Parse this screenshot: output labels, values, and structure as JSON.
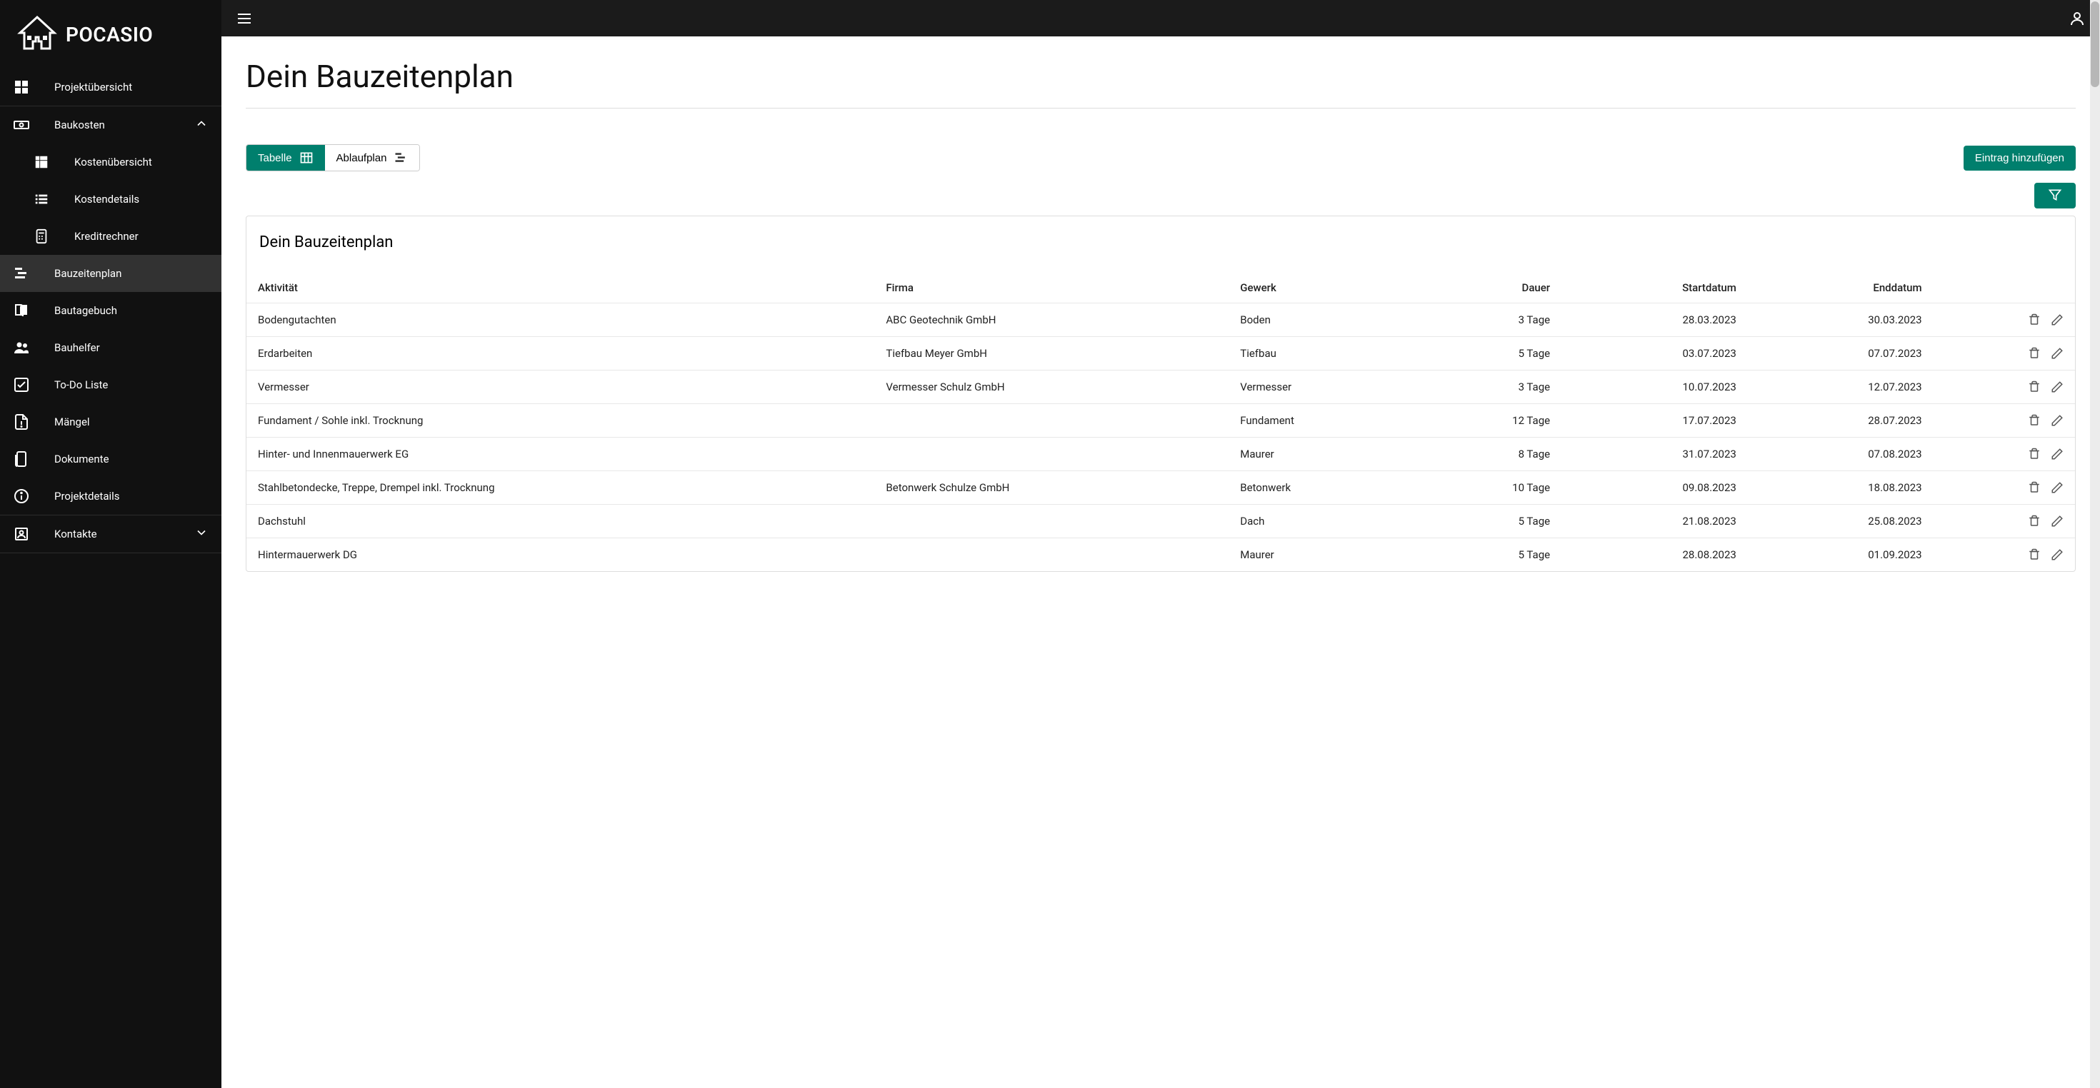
{
  "brand": {
    "name": "POCASIO"
  },
  "sidebar": {
    "items": [
      {
        "label": "Projektübersicht",
        "icon": "dashboard"
      },
      {
        "label": "Baukosten",
        "icon": "money",
        "expandable": true,
        "expanded": true,
        "children": [
          {
            "label": "Kostenübersicht",
            "icon": "grid"
          },
          {
            "label": "Kostendetails",
            "icon": "list"
          },
          {
            "label": "Kreditrechner",
            "icon": "calc"
          }
        ]
      },
      {
        "label": "Bauzeitenplan",
        "icon": "gantt",
        "active": true
      },
      {
        "label": "Bautagebuch",
        "icon": "book"
      },
      {
        "label": "Bauhelfer",
        "icon": "people"
      },
      {
        "label": "To-Do Liste",
        "icon": "check"
      },
      {
        "label": "Mängel",
        "icon": "note"
      },
      {
        "label": "Dokumente",
        "icon": "doc"
      },
      {
        "label": "Projektdetails",
        "icon": "info"
      },
      {
        "label": "Kontakte",
        "icon": "contacts",
        "expandable": true,
        "expanded": false
      }
    ]
  },
  "page": {
    "title": "Dein Bauzeitenplan",
    "tabs": {
      "table": "Tabelle",
      "gantt": "Ablaufplan"
    },
    "add_button": "Eintrag hinzufügen",
    "card_title": "Dein Bauzeitenplan"
  },
  "table": {
    "columns": [
      "Aktivität",
      "Firma",
      "Gewerk",
      "Dauer",
      "Startdatum",
      "Enddatum"
    ],
    "rows": [
      {
        "aktivitaet": "Bodengutachten",
        "firma": "ABC Geotechnik GmbH",
        "gewerk": "Boden",
        "dauer": "3 Tage",
        "start": "28.03.2023",
        "end": "30.03.2023"
      },
      {
        "aktivitaet": "Erdarbeiten",
        "firma": "Tiefbau Meyer GmbH",
        "gewerk": "Tiefbau",
        "dauer": "5 Tage",
        "start": "03.07.2023",
        "end": "07.07.2023"
      },
      {
        "aktivitaet": "Vermesser",
        "firma": "Vermesser Schulz GmbH",
        "gewerk": "Vermesser",
        "dauer": "3 Tage",
        "start": "10.07.2023",
        "end": "12.07.2023"
      },
      {
        "aktivitaet": "Fundament / Sohle inkl. Trocknung",
        "firma": "",
        "gewerk": "Fundament",
        "dauer": "12 Tage",
        "start": "17.07.2023",
        "end": "28.07.2023"
      },
      {
        "aktivitaet": "Hinter- und Innenmauerwerk EG",
        "firma": "",
        "gewerk": "Maurer",
        "dauer": "8 Tage",
        "start": "31.07.2023",
        "end": "07.08.2023"
      },
      {
        "aktivitaet": "Stahlbetondecke, Treppe, Drempel inkl. Trocknung",
        "firma": "Betonwerk Schulze GmbH",
        "gewerk": "Betonwerk",
        "dauer": "10 Tage",
        "start": "09.08.2023",
        "end": "18.08.2023"
      },
      {
        "aktivitaet": "Dachstuhl",
        "firma": "",
        "gewerk": "Dach",
        "dauer": "5 Tage",
        "start": "21.08.2023",
        "end": "25.08.2023"
      },
      {
        "aktivitaet": "Hintermauerwerk DG",
        "firma": "",
        "gewerk": "Maurer",
        "dauer": "5 Tage",
        "start": "28.08.2023",
        "end": "01.09.2023"
      }
    ]
  },
  "colors": {
    "accent": "#007f6d",
    "sidebar_bg": "#111"
  }
}
